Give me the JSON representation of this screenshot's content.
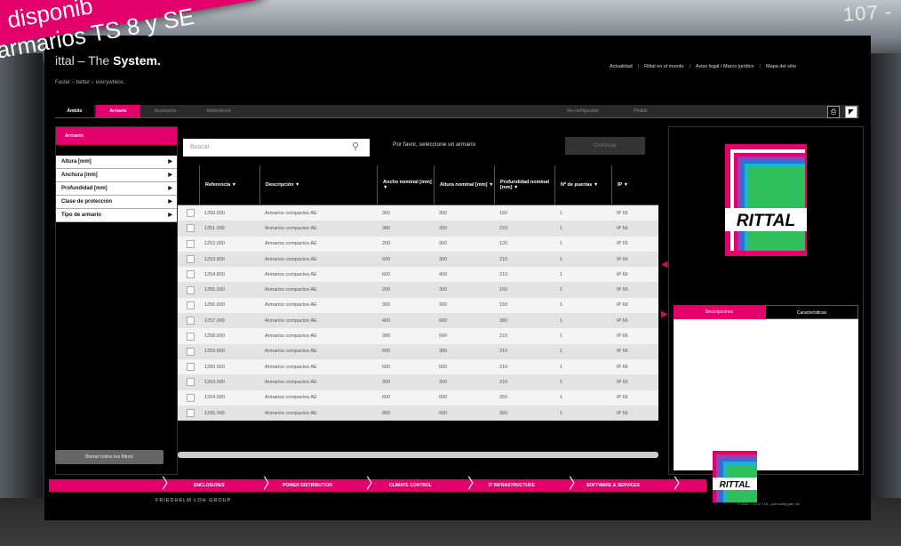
{
  "banner": {
    "line1": "disponib",
    "line2": "armarios TS 8 y SE"
  },
  "corner_number": "107 - ",
  "header": {
    "logo_prefix": "ittal – The ",
    "logo_bold": "System.",
    "tagline": "Faster – better – everywhere.",
    "links": [
      "Actualidad",
      "Rittal en el mundo",
      "Aviso legal / Marco jurídico",
      "Mapa del sitio"
    ]
  },
  "tabs": {
    "left": [
      "Ámbito",
      "Armario",
      "Accesorios",
      "Materialized"
    ],
    "right": [
      "Re-configurador",
      "Pedido"
    ]
  },
  "sidebar": {
    "title": "Armario",
    "filters": [
      "Altura [mm]",
      "Anchura [mm]",
      "Profundidad [mm]",
      "Clase de protección",
      "Tipo de armario"
    ],
    "clear_label": "Borrar todos los filtros"
  },
  "search": {
    "placeholder": "Buscar",
    "message": "Por favor, seleccione un armario",
    "continue_label": "Continuar"
  },
  "table": {
    "headers": [
      "Referencia ▼",
      "Descripción ▼",
      "Ancho nominal [mm] ▼",
      "Altura nominal [mm] ▼",
      "Profundidad nominal [mm] ▼",
      "Nº de puertas ▼",
      "IP ▼"
    ],
    "rows": [
      [
        "1250.000",
        "Armarios compactos AE",
        "300",
        "300",
        "150",
        "1",
        "IP 66"
      ],
      [
        "1251.000",
        "Armarios compactos AE",
        "380",
        "300",
        "210",
        "1",
        "IP 66"
      ],
      [
        "1252.000",
        "Armarios compactos AE",
        "200",
        "300",
        "120",
        "1",
        "IP 55"
      ],
      [
        "1253.800",
        "Armarios compactos AE",
        "600",
        "300",
        "210",
        "1",
        "IP 66"
      ],
      [
        "1254.800",
        "Armarios compactos AE",
        "600",
        "400",
        "210",
        "1",
        "IP 66"
      ],
      [
        "1255.000",
        "Armarios compactos AE",
        "200",
        "300",
        "150",
        "1",
        "IP 55"
      ],
      [
        "1256.000",
        "Armarios compactos AE",
        "300",
        "300",
        "150",
        "1",
        "IP 66"
      ],
      [
        "1257.000",
        "Armarios compactos AE",
        "400",
        "600",
        "380",
        "1",
        "IP 66"
      ],
      [
        "1258.000",
        "Armarios compactos AE",
        "380",
        "600",
        "210",
        "1",
        "IP 66"
      ],
      [
        "1259.800",
        "Armarios compactos AE",
        "600",
        "380",
        "210",
        "1",
        "IP 66"
      ],
      [
        "1260.000",
        "Armarios compactos AE",
        "600",
        "600",
        "210",
        "1",
        "IP 66"
      ],
      [
        "1263.000",
        "Armarios compactos AE",
        "300",
        "300",
        "210",
        "1",
        "IP 66"
      ],
      [
        "1264.000",
        "Armarios compactos AE",
        "600",
        "600",
        "250",
        "1",
        "IP 66"
      ],
      [
        "1265.000",
        "Armarios compactos AE",
        "800",
        "600",
        "300",
        "1",
        "IP 66"
      ]
    ]
  },
  "right_panel": {
    "logo_text": "RITTAL",
    "tabs": [
      "Descripciones",
      "Características"
    ]
  },
  "footer": {
    "items": [
      "ENCLOSURES",
      "POWER DISTRIBUTION",
      "CLIMATE CONTROL",
      "IT INFRASTRUCTURE",
      "SOFTWARE & SERVICES"
    ],
    "group": "FRIEDHELM LOH GROUP",
    "copyright": "© 2011 – 1.0.17.13 – pdf.config.pdf | 02",
    "logo_text": "RITTAL"
  },
  "colors": {
    "accent": "#e3006b",
    "bg": "#000000"
  },
  "icons": [
    "search-icon",
    "print-icon",
    "cursor-icon",
    "chevron-right-icon"
  ]
}
